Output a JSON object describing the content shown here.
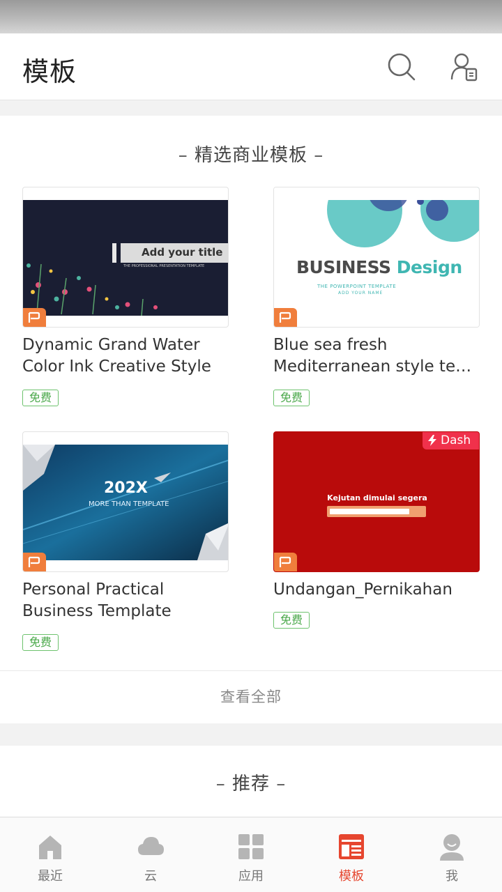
{
  "header": {
    "title": "模板"
  },
  "featured": {
    "title": "精选商业模板",
    "templates": [
      {
        "title_lines": [
          "Dynamic Grand Water",
          "Color Ink Creative Style"
        ],
        "badge": "免费",
        "thumb_text": "Add your title",
        "thumb_sub": "THE PROFESSIONAL PRESENTATION TEMPLATE"
      },
      {
        "title_lines": [
          "Blue sea fresh",
          "Mediterranean style tem…"
        ],
        "badge": "免费",
        "thumb_text_a": "BUSINESS",
        "thumb_text_b": "Design",
        "thumb_sub": "THE POWERPOINT TEMPLATE",
        "thumb_sub2": "ADD YOUR NAME"
      },
      {
        "title_lines": [
          "Personal Practical",
          "Business Template"
        ],
        "badge": "免费",
        "thumb_text": "202X",
        "thumb_sub": "MORE THAN TEMPLATE"
      },
      {
        "title_lines": [
          "Undangan_Pernikahan"
        ],
        "badge": "免费",
        "thumb_text": "Kejutan dimulai segera",
        "tag": "Dash"
      }
    ],
    "view_all": "查看全部"
  },
  "recommend": {
    "title": "推荐"
  },
  "nav": {
    "items": [
      {
        "label": "最近",
        "icon": "home-icon"
      },
      {
        "label": "云",
        "icon": "cloud-icon"
      },
      {
        "label": "应用",
        "icon": "apps-grid-icon"
      },
      {
        "label": "模板",
        "icon": "template-icon"
      },
      {
        "label": "我",
        "icon": "profile-icon"
      }
    ],
    "active_index": 3
  },
  "colors": {
    "accent": "#e6462f",
    "free_badge": "#6dc26d",
    "ppt_badge": "#f07e3c",
    "dash_badge": "#f0314b"
  }
}
